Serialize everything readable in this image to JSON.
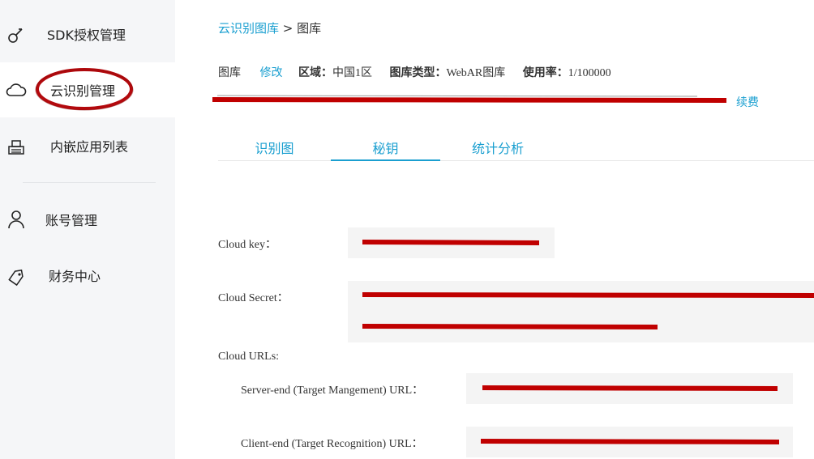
{
  "sidebar": {
    "items": [
      {
        "label": "SDK授权管理",
        "icon": "sdk-key-icon"
      },
      {
        "label": "云识别管理",
        "icon": "cloud-icon"
      },
      {
        "label": "内嵌应用列表",
        "icon": "printer-icon"
      },
      {
        "label": "账号管理",
        "icon": "user-icon"
      },
      {
        "label": "财务中心",
        "icon": "finance-tag-icon"
      }
    ]
  },
  "breadcrumb": {
    "parent": "云识别图库",
    "separator": " > ",
    "current": "图库"
  },
  "info": {
    "gallery_label": "图库",
    "edit_label": "修改",
    "region_label": "区域：",
    "region_value": "中国1区",
    "type_label": "图库类型：",
    "type_value": "WebAR图库",
    "usage_label": "使用率：",
    "usage_value": "1/100000",
    "renew_label": "续费"
  },
  "tabs": [
    {
      "label": "识别图",
      "active": false
    },
    {
      "label": "秘钥",
      "active": true
    },
    {
      "label": "统计分析",
      "active": false
    }
  ],
  "keys": {
    "cloud_key_label": "Cloud key：",
    "cloud_secret_label": "Cloud Secret：",
    "cloud_urls_label": "Cloud URLs:",
    "server_url_label": "Server-end (Target Mangement) URL：",
    "client_url_label": "Client-end (Target Recognition) URL："
  },
  "colors": {
    "accent": "#1a9fd0",
    "redaction": "#c00000",
    "sidebar_bg": "#f5f6f8"
  }
}
